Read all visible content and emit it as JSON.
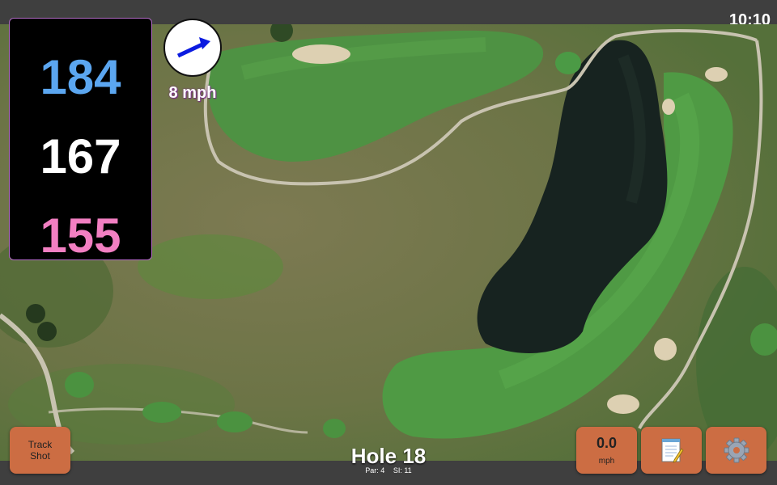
{
  "status": {
    "time": "10:10"
  },
  "distances": {
    "back": {
      "value": "184",
      "color": "#5ba6f0"
    },
    "middle": {
      "value": "167",
      "color": "#ffffff"
    },
    "front": {
      "value": "155",
      "color": "#f27fc2"
    }
  },
  "wind": {
    "speed_label": "8 mph",
    "arrow_icon": "wind-direction-arrow",
    "arrow_color": "#0b1be0",
    "arrow_heading_deg": 60
  },
  "hole": {
    "title": "Hole 18",
    "par_label": "Par: 4",
    "si_label": "SI: 11"
  },
  "buttons": {
    "track_shot_line1": "Track",
    "track_shot_line2": "Shot",
    "speed_value": "0.0",
    "speed_unit": "mph",
    "notes_icon": "notepad-icon",
    "settings_icon": "gear-icon",
    "button_color": "#cc6d43"
  },
  "map": {
    "fairway_color": "#4f9442",
    "water_color": "#15201c",
    "rough_color": "#6e7546",
    "path_color": "#c9c5b3",
    "bunker_color": "#dccfb1"
  }
}
